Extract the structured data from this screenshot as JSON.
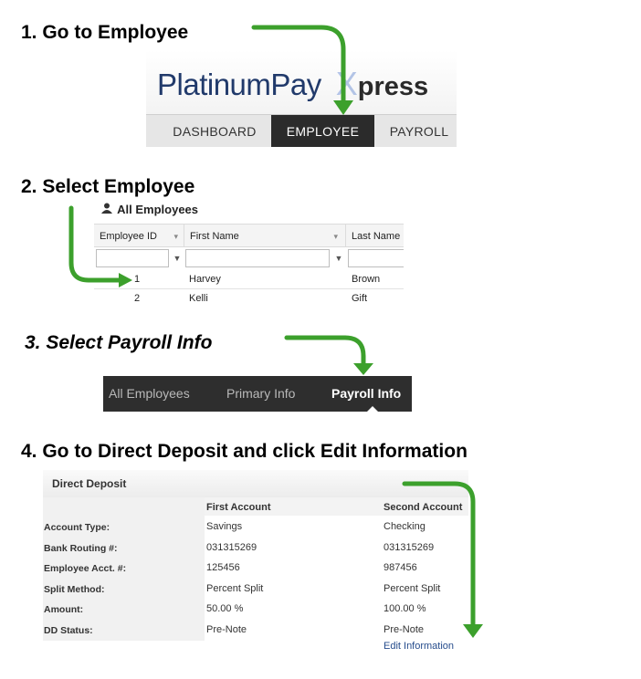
{
  "steps": {
    "step1": "1.  Go to Employee",
    "step2": "2.  Select Employee",
    "step3": "3.  Select Payroll Info",
    "step4": "4.  Go to Direct Deposit and click Edit Information"
  },
  "brand": {
    "main": "PlatinumPay",
    "x": "X",
    "rest": "press"
  },
  "top_nav": [
    "DASHBOARD",
    "EMPLOYEE",
    "PAYROLL"
  ],
  "top_nav_active": "EMPLOYEE",
  "grid": {
    "title": "All Employees",
    "columns": [
      "Employee ID",
      "First Name",
      "Last Name"
    ],
    "rows": [
      [
        "1",
        "Harvey",
        "Brown"
      ],
      [
        "2",
        "Kelli",
        "Gift"
      ]
    ]
  },
  "employee_tabs": [
    "All Employees",
    "Primary Info",
    "Payroll Info"
  ],
  "employee_tabs_active": "Payroll Info",
  "direct_deposit": {
    "title": "Direct Deposit",
    "columns": [
      "First Account",
      "Second Account"
    ],
    "fields": [
      {
        "label": "Account Type:",
        "first": "Savings",
        "second": "Checking"
      },
      {
        "label": "Bank Routing #:",
        "first": "031315269",
        "second": "031315269"
      },
      {
        "label": "Employee Acct. #:",
        "first": "125456",
        "second": "987456"
      },
      {
        "label": "Split Method:",
        "first": "Percent Split",
        "second": "Percent Split"
      },
      {
        "label": "Amount:",
        "first": "50.00 %",
        "second": "100.00 %"
      },
      {
        "label": "DD Status:",
        "first": "Pre-Note",
        "second": "Pre-Note"
      }
    ],
    "edit_link": "Edit Information"
  },
  "colors": {
    "arrow": "#3ca02c",
    "brand_blue": "#213a6b",
    "nav_active": "#2b2b2b",
    "tabbar": "#2e2e2e",
    "link": "#264c8c"
  },
  "icons": [
    "person-icon",
    "filter-icon",
    "arrow-annotation"
  ]
}
